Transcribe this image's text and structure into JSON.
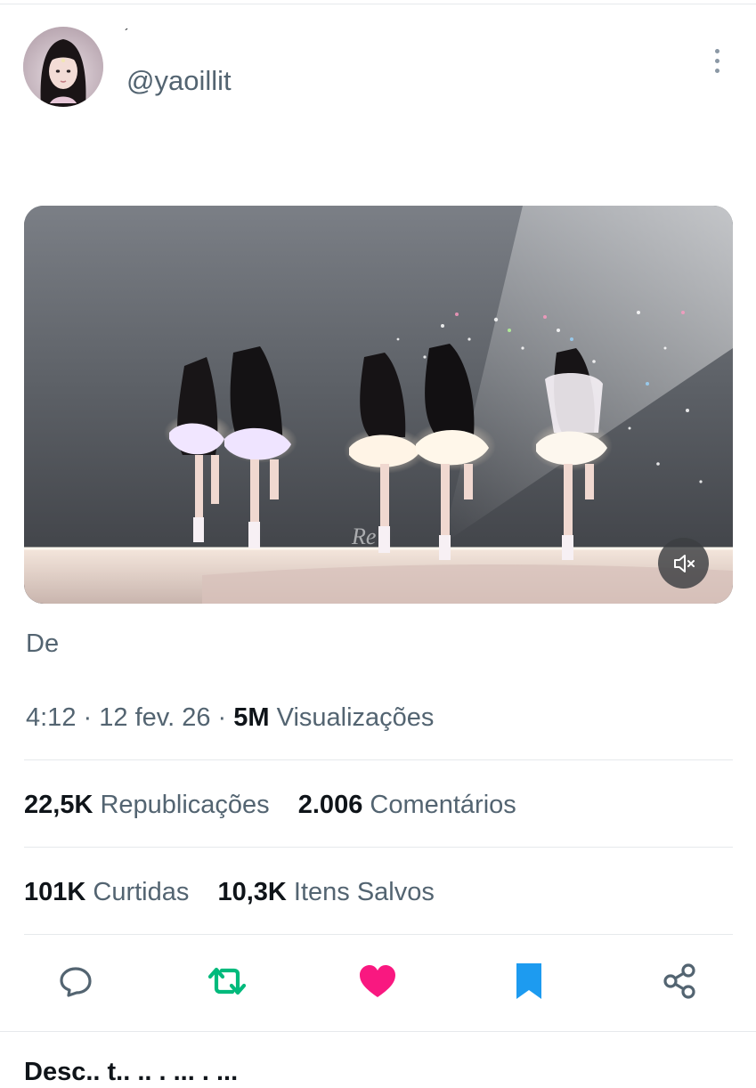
{
  "author": {
    "display_name": "´",
    "handle": "@yaoillit"
  },
  "post": {
    "text": "De",
    "time": "4:12",
    "date": "12 fev. 26",
    "separator": "·",
    "views_count": "5M",
    "views_label": "Visualizações",
    "media": {
      "watermark": "Re",
      "muted": true
    }
  },
  "stats": {
    "reposts_count": "22,5K",
    "reposts_label": "Republicações",
    "comments_count": "2.006",
    "comments_label": "Comentários",
    "likes_count": "101K",
    "likes_label": "Curtidas",
    "bookmarks_count": "10,3K",
    "bookmarks_label": "Itens Salvos"
  },
  "actions": {
    "reply_icon": "speech-bubble-icon",
    "repost_icon": "repost-arrows-icon",
    "like_icon": "heart-icon",
    "bookmark_icon": "bookmark-icon",
    "share_icon": "share-nodes-icon"
  },
  "colors": {
    "repost_active": "#00ba7c",
    "like_active": "#f91880",
    "bookmark_active": "#1d9bf0",
    "secondary_text": "#536471",
    "primary_text": "#0f1419"
  },
  "next_section": {
    "heading": "Desc.. t.. .. . ... . ..."
  }
}
